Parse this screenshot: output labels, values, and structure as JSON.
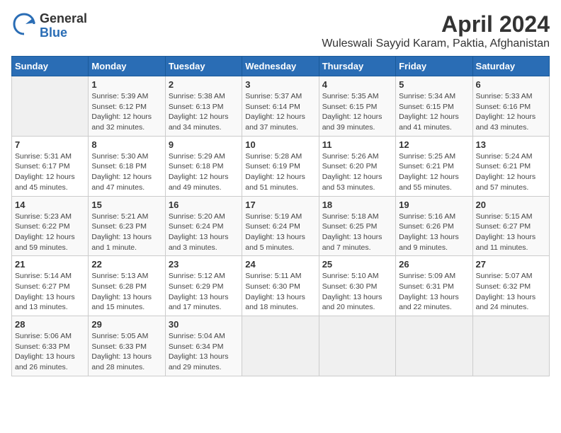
{
  "logo": {
    "general": "General",
    "blue": "Blue"
  },
  "title": "April 2024",
  "location": "Wuleswali Sayyid Karam, Paktia, Afghanistan",
  "weekdays": [
    "Sunday",
    "Monday",
    "Tuesday",
    "Wednesday",
    "Thursday",
    "Friday",
    "Saturday"
  ],
  "weeks": [
    [
      {
        "day": "",
        "sunrise": "",
        "sunset": "",
        "daylight": ""
      },
      {
        "day": "1",
        "sunrise": "Sunrise: 5:39 AM",
        "sunset": "Sunset: 6:12 PM",
        "daylight": "Daylight: 12 hours and 32 minutes."
      },
      {
        "day": "2",
        "sunrise": "Sunrise: 5:38 AM",
        "sunset": "Sunset: 6:13 PM",
        "daylight": "Daylight: 12 hours and 34 minutes."
      },
      {
        "day": "3",
        "sunrise": "Sunrise: 5:37 AM",
        "sunset": "Sunset: 6:14 PM",
        "daylight": "Daylight: 12 hours and 37 minutes."
      },
      {
        "day": "4",
        "sunrise": "Sunrise: 5:35 AM",
        "sunset": "Sunset: 6:15 PM",
        "daylight": "Daylight: 12 hours and 39 minutes."
      },
      {
        "day": "5",
        "sunrise": "Sunrise: 5:34 AM",
        "sunset": "Sunset: 6:15 PM",
        "daylight": "Daylight: 12 hours and 41 minutes."
      },
      {
        "day": "6",
        "sunrise": "Sunrise: 5:33 AM",
        "sunset": "Sunset: 6:16 PM",
        "daylight": "Daylight: 12 hours and 43 minutes."
      }
    ],
    [
      {
        "day": "7",
        "sunrise": "Sunrise: 5:31 AM",
        "sunset": "Sunset: 6:17 PM",
        "daylight": "Daylight: 12 hours and 45 minutes."
      },
      {
        "day": "8",
        "sunrise": "Sunrise: 5:30 AM",
        "sunset": "Sunset: 6:18 PM",
        "daylight": "Daylight: 12 hours and 47 minutes."
      },
      {
        "day": "9",
        "sunrise": "Sunrise: 5:29 AM",
        "sunset": "Sunset: 6:18 PM",
        "daylight": "Daylight: 12 hours and 49 minutes."
      },
      {
        "day": "10",
        "sunrise": "Sunrise: 5:28 AM",
        "sunset": "Sunset: 6:19 PM",
        "daylight": "Daylight: 12 hours and 51 minutes."
      },
      {
        "day": "11",
        "sunrise": "Sunrise: 5:26 AM",
        "sunset": "Sunset: 6:20 PM",
        "daylight": "Daylight: 12 hours and 53 minutes."
      },
      {
        "day": "12",
        "sunrise": "Sunrise: 5:25 AM",
        "sunset": "Sunset: 6:21 PM",
        "daylight": "Daylight: 12 hours and 55 minutes."
      },
      {
        "day": "13",
        "sunrise": "Sunrise: 5:24 AM",
        "sunset": "Sunset: 6:21 PM",
        "daylight": "Daylight: 12 hours and 57 minutes."
      }
    ],
    [
      {
        "day": "14",
        "sunrise": "Sunrise: 5:23 AM",
        "sunset": "Sunset: 6:22 PM",
        "daylight": "Daylight: 12 hours and 59 minutes."
      },
      {
        "day": "15",
        "sunrise": "Sunrise: 5:21 AM",
        "sunset": "Sunset: 6:23 PM",
        "daylight": "Daylight: 13 hours and 1 minute."
      },
      {
        "day": "16",
        "sunrise": "Sunrise: 5:20 AM",
        "sunset": "Sunset: 6:24 PM",
        "daylight": "Daylight: 13 hours and 3 minutes."
      },
      {
        "day": "17",
        "sunrise": "Sunrise: 5:19 AM",
        "sunset": "Sunset: 6:24 PM",
        "daylight": "Daylight: 13 hours and 5 minutes."
      },
      {
        "day": "18",
        "sunrise": "Sunrise: 5:18 AM",
        "sunset": "Sunset: 6:25 PM",
        "daylight": "Daylight: 13 hours and 7 minutes."
      },
      {
        "day": "19",
        "sunrise": "Sunrise: 5:16 AM",
        "sunset": "Sunset: 6:26 PM",
        "daylight": "Daylight: 13 hours and 9 minutes."
      },
      {
        "day": "20",
        "sunrise": "Sunrise: 5:15 AM",
        "sunset": "Sunset: 6:27 PM",
        "daylight": "Daylight: 13 hours and 11 minutes."
      }
    ],
    [
      {
        "day": "21",
        "sunrise": "Sunrise: 5:14 AM",
        "sunset": "Sunset: 6:27 PM",
        "daylight": "Daylight: 13 hours and 13 minutes."
      },
      {
        "day": "22",
        "sunrise": "Sunrise: 5:13 AM",
        "sunset": "Sunset: 6:28 PM",
        "daylight": "Daylight: 13 hours and 15 minutes."
      },
      {
        "day": "23",
        "sunrise": "Sunrise: 5:12 AM",
        "sunset": "Sunset: 6:29 PM",
        "daylight": "Daylight: 13 hours and 17 minutes."
      },
      {
        "day": "24",
        "sunrise": "Sunrise: 5:11 AM",
        "sunset": "Sunset: 6:30 PM",
        "daylight": "Daylight: 13 hours and 18 minutes."
      },
      {
        "day": "25",
        "sunrise": "Sunrise: 5:10 AM",
        "sunset": "Sunset: 6:30 PM",
        "daylight": "Daylight: 13 hours and 20 minutes."
      },
      {
        "day": "26",
        "sunrise": "Sunrise: 5:09 AM",
        "sunset": "Sunset: 6:31 PM",
        "daylight": "Daylight: 13 hours and 22 minutes."
      },
      {
        "day": "27",
        "sunrise": "Sunrise: 5:07 AM",
        "sunset": "Sunset: 6:32 PM",
        "daylight": "Daylight: 13 hours and 24 minutes."
      }
    ],
    [
      {
        "day": "28",
        "sunrise": "Sunrise: 5:06 AM",
        "sunset": "Sunset: 6:33 PM",
        "daylight": "Daylight: 13 hours and 26 minutes."
      },
      {
        "day": "29",
        "sunrise": "Sunrise: 5:05 AM",
        "sunset": "Sunset: 6:33 PM",
        "daylight": "Daylight: 13 hours and 28 minutes."
      },
      {
        "day": "30",
        "sunrise": "Sunrise: 5:04 AM",
        "sunset": "Sunset: 6:34 PM",
        "daylight": "Daylight: 13 hours and 29 minutes."
      },
      {
        "day": "",
        "sunrise": "",
        "sunset": "",
        "daylight": ""
      },
      {
        "day": "",
        "sunrise": "",
        "sunset": "",
        "daylight": ""
      },
      {
        "day": "",
        "sunrise": "",
        "sunset": "",
        "daylight": ""
      },
      {
        "day": "",
        "sunrise": "",
        "sunset": "",
        "daylight": ""
      }
    ]
  ]
}
